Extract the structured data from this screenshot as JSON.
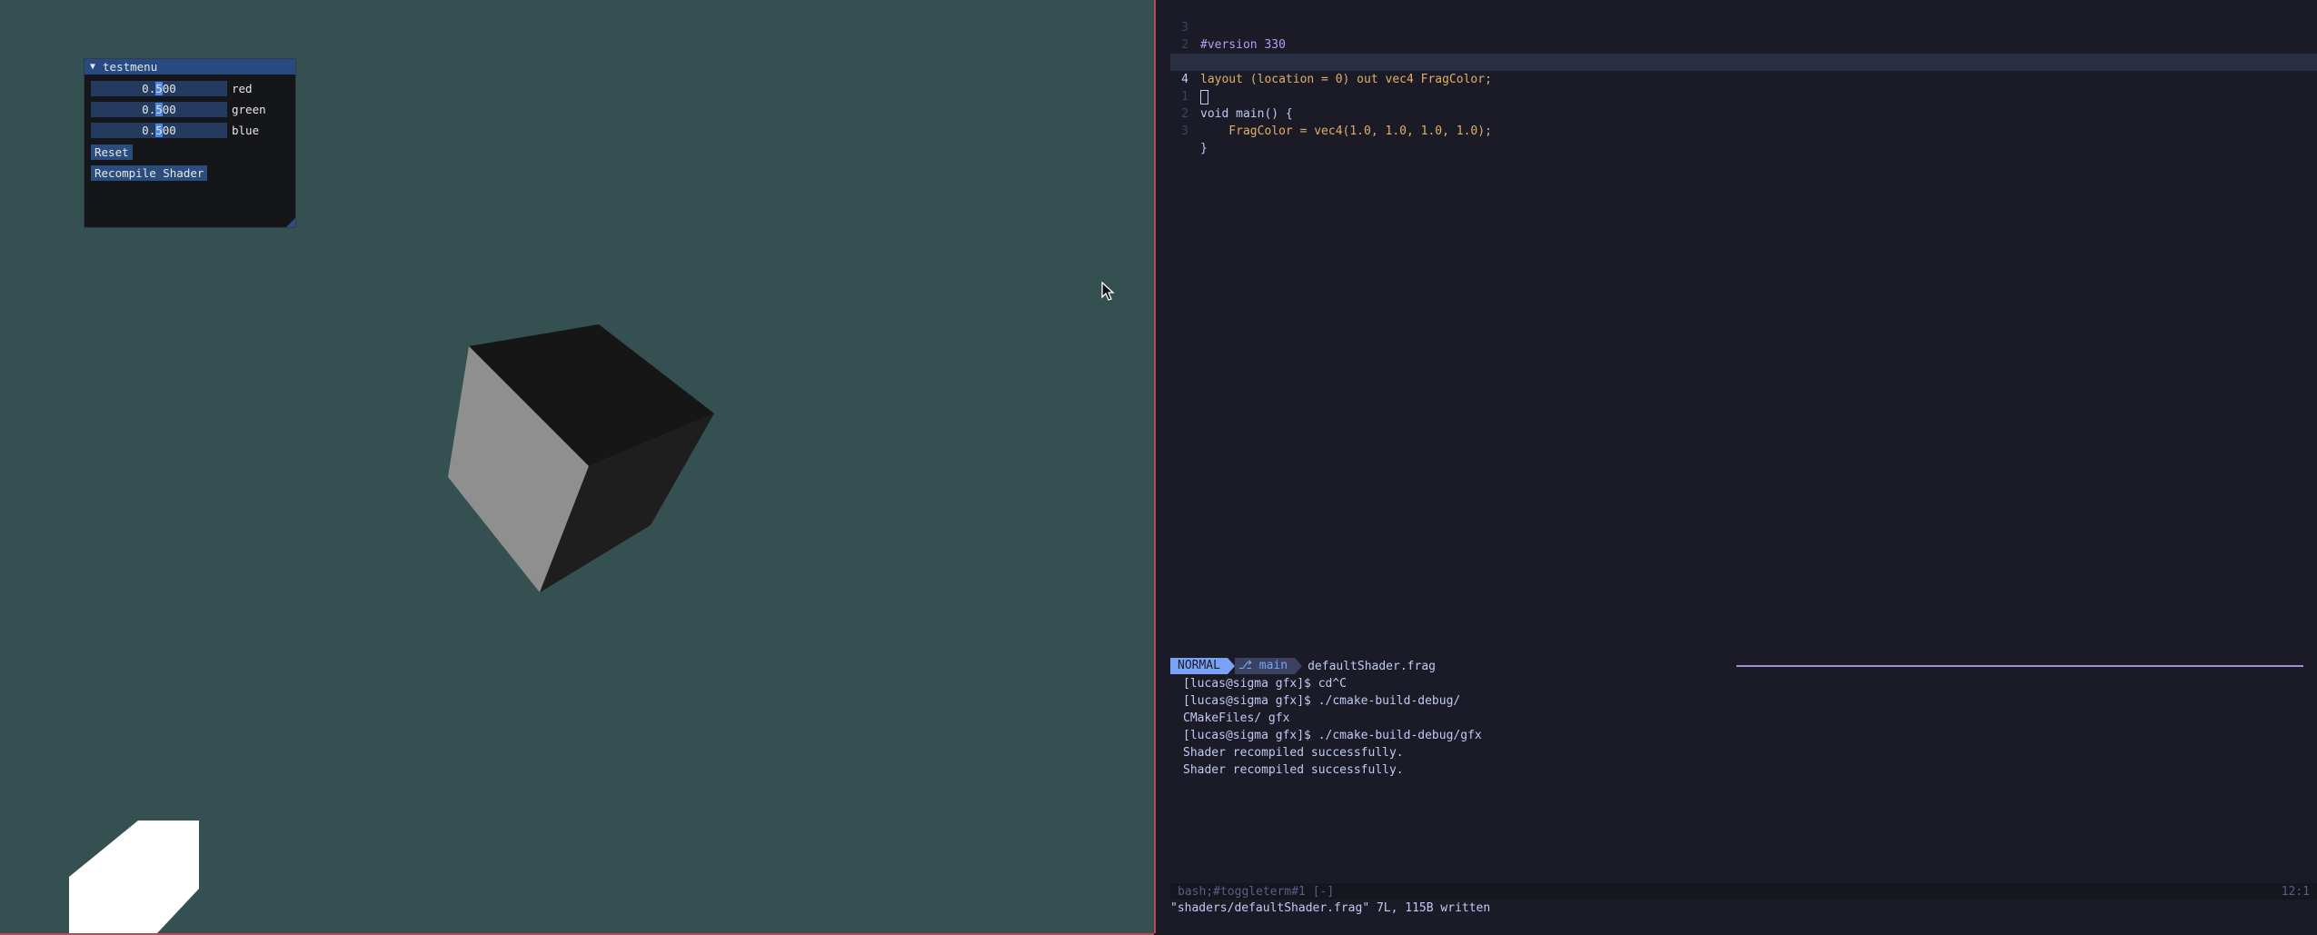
{
  "colors": {
    "viewport_bg": "#345050",
    "editor_bg": "#1a1b26",
    "accent": "#7aa2f7",
    "divider": "#b84a5a",
    "imgui_title": "#284a82"
  },
  "imgui": {
    "title": "testmenu",
    "collapse_glyph": "▼",
    "sliders": [
      {
        "value": "0.500",
        "label": "red",
        "level": 0.5
      },
      {
        "value": "0.500",
        "label": "green",
        "level": 0.5
      },
      {
        "value": "0.500",
        "label": "blue",
        "level": 0.5
      }
    ],
    "reset_label": "Reset",
    "recompile_label": "Recompile Shader"
  },
  "editor": {
    "lines": [
      {
        "num": "3",
        "kind": "version",
        "text": "#version 330"
      },
      {
        "num": "2",
        "kind": "blank",
        "text": ""
      },
      {
        "num": "1",
        "kind": "layout",
        "text": "layout (location = 0) out vec4 FragColor;"
      },
      {
        "num": "4",
        "kind": "cursor",
        "text": ""
      },
      {
        "num": "1",
        "kind": "main",
        "text": "void main() {"
      },
      {
        "num": "2",
        "kind": "body",
        "text": "    FragColor = vec4(1.0, 1.0, 1.0, 1.0);"
      },
      {
        "num": "3",
        "kind": "close",
        "text": "}"
      }
    ]
  },
  "statusline": {
    "mode": "NORMAL",
    "branch": " main",
    "filename": "defaultShader.frag"
  },
  "terminal": {
    "lines": [
      "[lucas@sigma gfx]$ cd^C",
      "[lucas@sigma gfx]$ ./cmake-build-debug/",
      "CMakeFiles/ gfx",
      "[lucas@sigma gfx]$ ./cmake-build-debug/gfx",
      "Shader recompiled successfully.",
      "Shader recompiled successfully."
    ]
  },
  "toggleterm": {
    "left": "bash;#toggleterm#1 [-]",
    "right": "12:1"
  },
  "message": "\"shaders/defaultShader.frag\" 7L, 115B written"
}
